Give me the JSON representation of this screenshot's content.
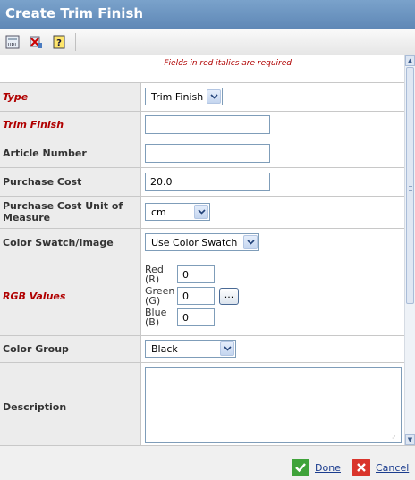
{
  "window": {
    "title": "Create Trim Finish"
  },
  "toolbar": {
    "icons": [
      "url-icon",
      "clear-format-icon",
      "help-icon"
    ],
    "url_icon_text": "URL",
    "help_icon_text": "?"
  },
  "form": {
    "required_note": "Fields in red italics are required",
    "type": {
      "label": "Type",
      "value": "Trim Finish"
    },
    "trim_finish": {
      "label": "Trim Finish",
      "value": ""
    },
    "article_number": {
      "label": "Article Number",
      "value": ""
    },
    "purchase_cost": {
      "label": "Purchase Cost",
      "value": "20.0"
    },
    "purchase_cost_uom": {
      "label": "Purchase Cost Unit of Measure",
      "value": "cm"
    },
    "color_swatch": {
      "label": "Color Swatch/Image",
      "value": "Use Color Swatch"
    },
    "rgb": {
      "label": "RGB Values",
      "red": {
        "label": "Red (R)",
        "value": "0"
      },
      "green": {
        "label": "Green (G)",
        "value": "0"
      },
      "blue": {
        "label": "Blue (B)",
        "value": "0"
      },
      "picker_label": "..."
    },
    "color_group": {
      "label": "Color Group",
      "value": "Black"
    },
    "description": {
      "label": "Description",
      "value": ""
    }
  },
  "footer": {
    "done_label": "Done",
    "cancel_label": "Cancel"
  },
  "colors": {
    "titlebar": "#6a93c0",
    "required": "#b00000",
    "done_icon": "#3fa33a",
    "cancel_icon": "#d9342b"
  }
}
